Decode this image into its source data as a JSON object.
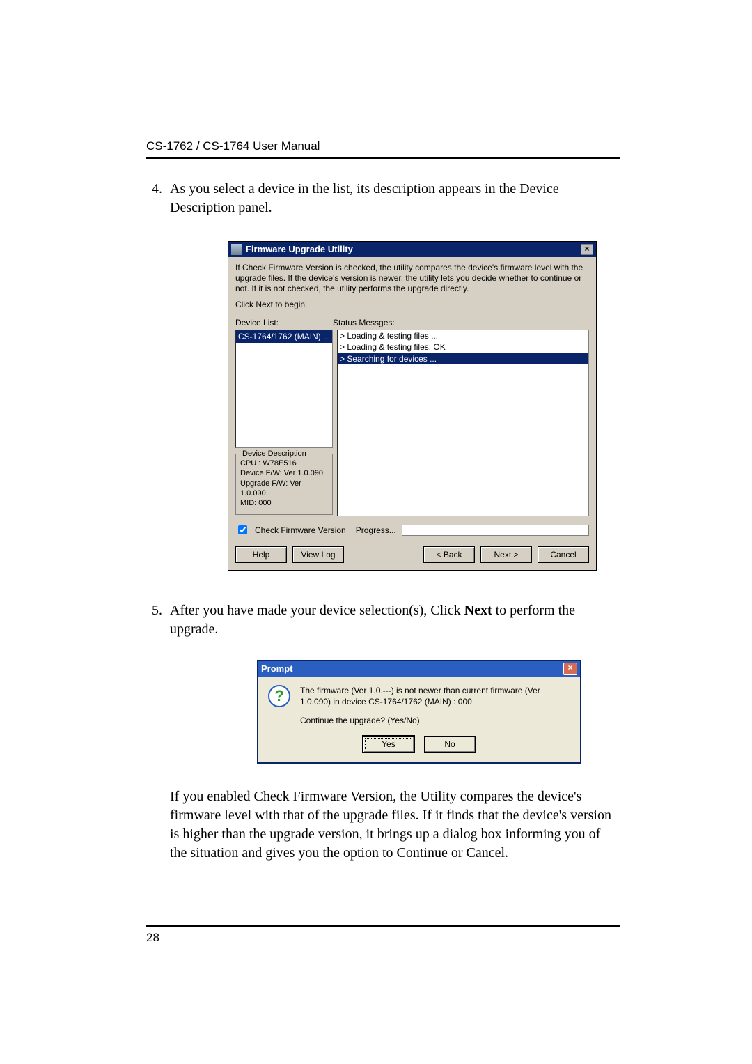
{
  "header": {
    "running_title": "CS-1762 / CS-1764 User Manual"
  },
  "steps": {
    "item4": "As you select a device in the list, its description appears in the Device Description panel.",
    "item5_pre": "After you have made your device selection(s), Click ",
    "item5_bold": "Next",
    "item5_post": " to perform the upgrade.",
    "item5_para": "If you enabled Check Firmware Version, the Utility compares the device's firmware level with that of the upgrade files. If it finds that the device's version is higher than the upgrade version, it brings up a dialog box informing you of the situation and gives you the option to Continue or Cancel."
  },
  "window": {
    "title": "Firmware Upgrade Utility",
    "instructions": {
      "p1": "If Check Firmware Version is checked, the utility compares the device's firmware level with the upgrade files. If the device's version is newer, the utility lets you decide whether to continue or not. If it is not checked, the utility performs the upgrade directly.",
      "p2": "Click Next to begin."
    },
    "labels": {
      "device_list": "Device List:",
      "status_messages": "Status Messges:",
      "device_description": "Device Description",
      "check_fw": "Check Firmware Version",
      "progress": "Progress..."
    },
    "device_list": {
      "selected": "CS-1764/1762 (MAIN) ..."
    },
    "device_description": {
      "cpu": "CPU : W78E516",
      "device_fw": "Device F/W: Ver 1.0.090",
      "upgrade_fw": "Upgrade F/W: Ver 1.0.090",
      "mid": "MID: 000"
    },
    "status": {
      "line1": "> Loading & testing files ...",
      "line2": "> Loading & testing files: OK",
      "line3": "> Searching for devices ..."
    },
    "buttons": {
      "help": "Help",
      "view_log": "View Log",
      "back": "< Back",
      "next": "Next >",
      "cancel": "Cancel"
    },
    "check_fw_checked": true
  },
  "prompt": {
    "title": "Prompt",
    "line1": "The firmware (Ver 1.0.---) is not newer than current firmware (Ver 1.0.090) in device CS-1764/1762 (MAIN) : 000",
    "line2": "Continue the upgrade? (Yes/No)",
    "yes": "Yes",
    "no": "No"
  },
  "footer": {
    "page_number": "28"
  }
}
